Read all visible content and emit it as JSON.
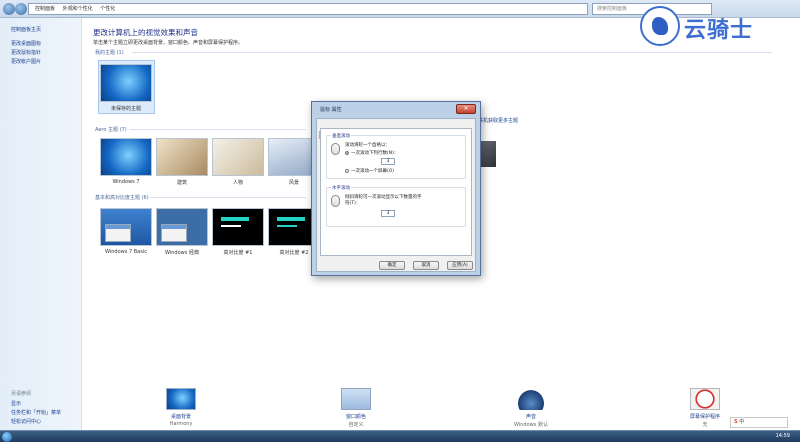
{
  "address_bar": {
    "crumbs": [
      "控制面板",
      "外观和个性化",
      "个性化"
    ],
    "search_placeholder": "搜索控制面板"
  },
  "left_pane": {
    "home": "控制面板主页",
    "links": [
      "更改桌面图标",
      "更改鼠标指针",
      "更改帐户图片"
    ],
    "see_also_title": "另请参阅",
    "see_also": [
      "显示",
      "任务栏和「开始」菜单",
      "轻松访问中心"
    ]
  },
  "main": {
    "heading": "更改计算机上的视觉效果和声音",
    "subheading": "单击某个主题立即更改桌面背景、窗口颜色、声音和屏幕保护程序。",
    "my_themes_label": "我的主题 (1)",
    "my_themes": [
      {
        "name": "未保存的主题"
      }
    ],
    "aero_label": "Aero 主题 (7)",
    "aero_themes": [
      {
        "name": "Windows 7"
      },
      {
        "name": "建筑"
      },
      {
        "name": "人物"
      },
      {
        "name": "风景"
      }
    ],
    "online_link": "联机获取更多主题",
    "basic_label": "基本和高对比度主题 (6)",
    "basic_themes": [
      {
        "name": "Windows 7 Basic"
      },
      {
        "name": "Windows 经典"
      },
      {
        "name": "高对比度 #1"
      },
      {
        "name": "高对比度 #2"
      }
    ]
  },
  "tray": [
    {
      "title": "桌面背景",
      "sub": "Harmony"
    },
    {
      "title": "窗口颜色",
      "sub": "自定义"
    },
    {
      "title": "声音",
      "sub": "Windows 默认"
    },
    {
      "title": "屏幕保护程序",
      "sub": "无"
    }
  ],
  "dialog": {
    "title": "鼠标 属性",
    "close": "✕",
    "tabs": [
      "鼠标键",
      "指针",
      "指针选项",
      "滑轮",
      "硬件"
    ],
    "active_tab": "滑轮",
    "vertical": {
      "title": "垂直滚动",
      "desc": "滚动滑轮一个齿格以：",
      "option1": "一次滚动下列行数(N)：",
      "lines": "3",
      "option2": "一次滚动一个屏幕(O)"
    },
    "horizontal": {
      "title": "水平滚动",
      "desc": "倾斜滑轮可一次滚动显示以下数量的字",
      "desc2": "符(T)：",
      "chars": "3"
    },
    "buttons": [
      "确定",
      "取消",
      "应用(A)"
    ]
  },
  "watermark": {
    "text": "云骑士"
  },
  "taskbar": {
    "ime": "中",
    "clock": "14:59"
  }
}
